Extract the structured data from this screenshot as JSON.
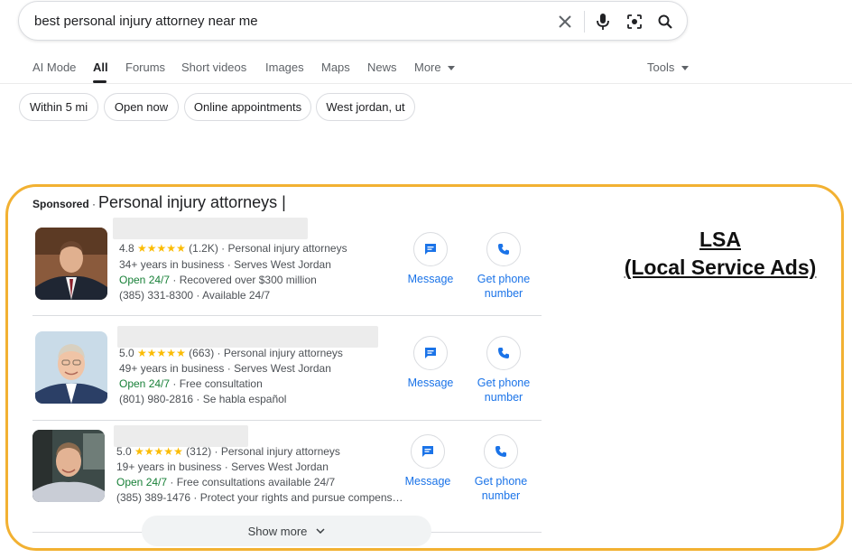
{
  "search": {
    "query": "best personal injury attorney near me",
    "icons": [
      "close-icon",
      "microphone-icon",
      "lens-icon",
      "search-icon"
    ]
  },
  "tabs": [
    {
      "label": "AI Mode",
      "active": false
    },
    {
      "label": "All",
      "active": true
    },
    {
      "label": "Forums",
      "active": false
    },
    {
      "label": "Short videos",
      "active": false
    },
    {
      "label": "Images",
      "active": false
    },
    {
      "label": "Maps",
      "active": false
    },
    {
      "label": "News",
      "active": false
    },
    {
      "label": "More",
      "active": false
    },
    {
      "label": "Tools",
      "active": false
    }
  ],
  "chips": [
    "Within 5 mi",
    "Open now",
    "Online appointments",
    "West jordan, ut"
  ],
  "sponsored": {
    "label": "Sponsored",
    "separator": "·",
    "title": "Personal injury attorneys |"
  },
  "annotation": {
    "line1": "LSA",
    "line2": "(Local Service Ads)",
    "color": "#f2b132"
  },
  "listings": [
    {
      "rating": "4.8",
      "stars": "★★★★★",
      "reviews_category": "(1.2K) · Personal injury attorneys",
      "years": "34+ years in business · Serves West Jordan",
      "open": "Open 24/7",
      "open_extra": " · Recovered over $300 million",
      "phone_line": "(385) 331-8300 · Available 24/7",
      "message_label": "Message",
      "call_label": "Get phone number"
    },
    {
      "rating": "5.0",
      "stars": "★★★★★",
      "reviews_category": "(663) · Personal injury attorneys",
      "years": "49+ years in business · Serves West Jordan",
      "open": "Open 24/7",
      "open_extra": " · Free consultation",
      "phone_line": "(801) 980-2816 · Se habla español",
      "message_label": "Message",
      "call_label": "Get phone number"
    },
    {
      "rating": "5.0",
      "stars": "★★★★★",
      "reviews_category": "(312) · Personal injury attorneys",
      "years": "19+ years in business · Serves West Jordan",
      "open": "Open 24/7",
      "open_extra": " · Free consultations available 24/7",
      "phone_line": "(385) 389-1476 · Protect your rights and pursue compens…",
      "message_label": "Message",
      "call_label": "Get phone number"
    }
  ],
  "show_more": {
    "label": "Show more"
  },
  "colors": {
    "link": "#1a73e8",
    "open": "#188038",
    "star": "#fbbc04",
    "highlight": "#f2b132"
  }
}
